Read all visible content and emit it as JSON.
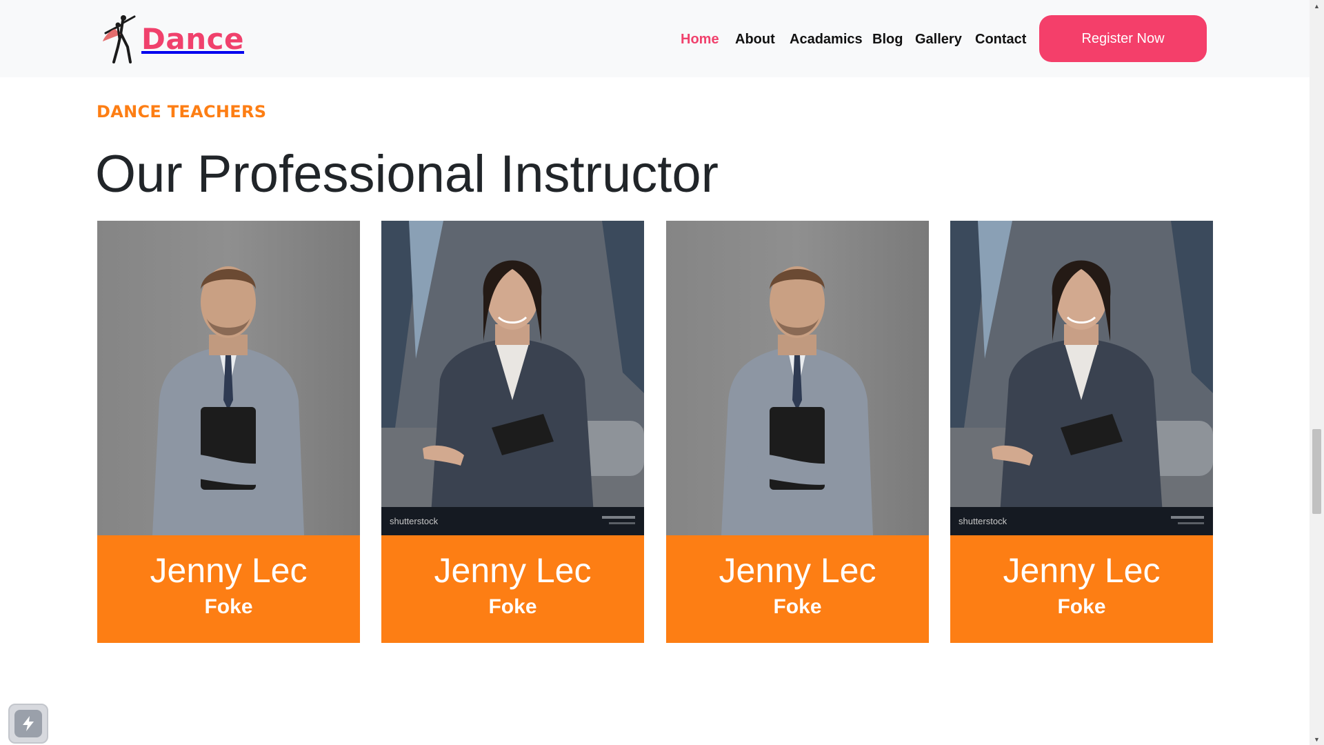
{
  "brand": {
    "name": "Dance",
    "color": "#f0416c"
  },
  "nav": {
    "items": [
      {
        "label": "Home",
        "active": true
      },
      {
        "label": "About",
        "active": false
      },
      {
        "label": "Acadamics",
        "active": false
      },
      {
        "label": "Blog",
        "active": false
      },
      {
        "label": "Gallery",
        "active": false
      },
      {
        "label": "Contact",
        "active": false
      }
    ],
    "cta_label": "Register Now",
    "cta_color": "#f43f6a"
  },
  "section": {
    "eyebrow": "DANCE TEACHERS",
    "title": "Our Professional Instructor",
    "accent_color": "#fd7e14"
  },
  "instructors": [
    {
      "name": "Jenny Lec",
      "role": "Foke",
      "photo": "man-with-folder-photo"
    },
    {
      "name": "Jenny Lec",
      "role": "Foke",
      "photo": "woman-in-office-photo",
      "watermark": "shutterstock"
    },
    {
      "name": "Jenny Lec",
      "role": "Foke",
      "photo": "man-with-folder-photo"
    },
    {
      "name": "Jenny Lec",
      "role": "Foke",
      "photo": "woman-in-office-photo",
      "watermark": "shutterstock"
    }
  ],
  "icons": {
    "widget": "lightning-icon",
    "scroll_up": "scroll-up-arrow-icon",
    "scroll_down": "scroll-down-arrow-icon"
  }
}
